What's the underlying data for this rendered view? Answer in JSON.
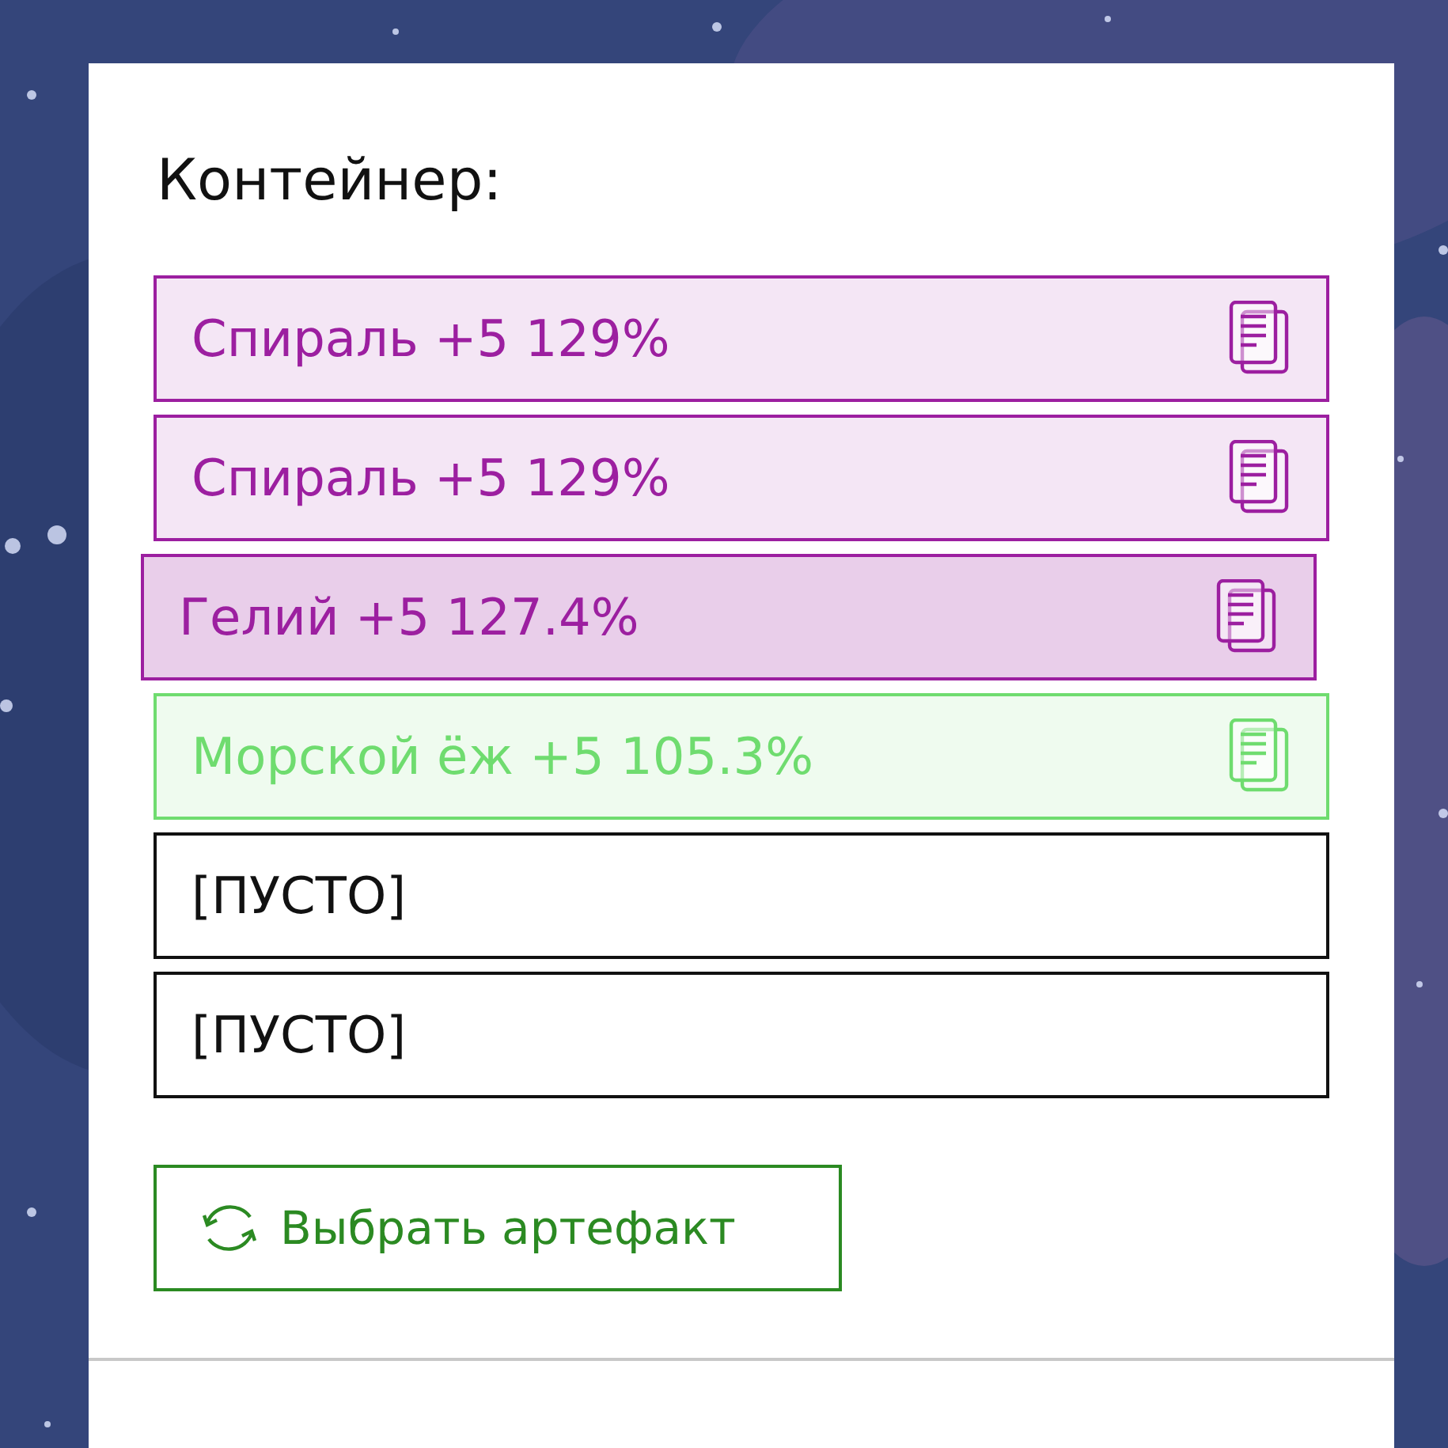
{
  "title": "Контейнер:",
  "slots": [
    {
      "kind": "artifact",
      "label": "Спираль +5 129%",
      "color": "#9c1fa0",
      "selected": false
    },
    {
      "kind": "artifact",
      "label": "Спираль +5 129%",
      "color": "#9c1fa0",
      "selected": false
    },
    {
      "kind": "artifact",
      "label": "Гелий +5 127.4%",
      "color": "#9c1fa0",
      "selected": true
    },
    {
      "kind": "artifact",
      "label": "Морской ёж +5 105.3%",
      "color": "#6fdc6f",
      "selected": false
    },
    {
      "kind": "empty",
      "label": "[ПУСТО]"
    },
    {
      "kind": "empty",
      "label": "[ПУСТО]"
    }
  ],
  "button": {
    "label": "Выбрать артефакт"
  }
}
